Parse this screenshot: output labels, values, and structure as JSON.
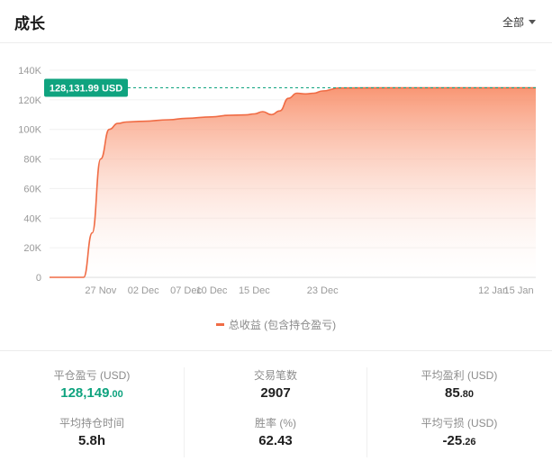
{
  "header": {
    "title": "成长",
    "range_label": "全部"
  },
  "legend": {
    "label": "总收益 (包含持仓盈亏)"
  },
  "stats": {
    "realized_pnl": {
      "label": "平仓盈亏 (USD)",
      "int": "128,149",
      "dec": ".00"
    },
    "trade_count": {
      "label": "交易笔数",
      "value": "2907"
    },
    "avg_profit": {
      "label": "平均盈利 (USD)",
      "int": "85",
      "dec": ".80"
    },
    "avg_hold_time": {
      "label": "平均持仓时间",
      "value": "5.8h"
    },
    "win_rate": {
      "label": "胜率 (%)",
      "value": "62.43"
    },
    "avg_loss": {
      "label": "平均亏损 (USD)",
      "int": "-25",
      "dec": ".26"
    }
  },
  "colors": {
    "line": "#f06c45",
    "fill_top": "#f8916d",
    "marker_bg": "#0fa37f",
    "positive": "#0fa37f"
  },
  "chart_data": {
    "type": "area",
    "series": [
      {
        "name": "总收益 (包含持仓盈亏)",
        "x": [
          "2023-11-21",
          "2023-11-22",
          "2023-11-23",
          "2023-11-24",
          "2023-11-25",
          "2023-11-26",
          "2023-11-27",
          "2023-11-28",
          "2023-11-29",
          "2023-11-30",
          "2023-12-02",
          "2023-12-05",
          "2023-12-07",
          "2023-12-10",
          "2023-12-12",
          "2023-12-14",
          "2023-12-15",
          "2023-12-16",
          "2023-12-17",
          "2023-12-18",
          "2023-12-19",
          "2023-12-20",
          "2023-12-21",
          "2023-12-22",
          "2023-12-23",
          "2023-12-25",
          "2024-01-02",
          "2024-01-12",
          "2024-01-15",
          "2024-01-17"
        ],
        "values": [
          0,
          0,
          0,
          0,
          0,
          30000,
          80000,
          100000,
          104000,
          105000,
          105500,
          106500,
          107500,
          108500,
          109500,
          109800,
          110500,
          112000,
          110000,
          112500,
          121000,
          124500,
          124000,
          124500,
          126000,
          128000,
          128100,
          128150,
          128131.99,
          128131.99
        ]
      }
    ],
    "x_ticks": [
      "27 Nov",
      "02 Dec",
      "07 Dec",
      "10 Dec",
      "15 Dec",
      "23 Dec",
      "12 Jan",
      "15 Jan"
    ],
    "y_ticks": [
      "0",
      "20K",
      "40K",
      "60K",
      "80K",
      "100K",
      "120K",
      "140K"
    ],
    "ylim": [
      0,
      140000
    ],
    "last_value": 128131.99,
    "last_value_label": "128,131.99 USD",
    "grid": true
  }
}
